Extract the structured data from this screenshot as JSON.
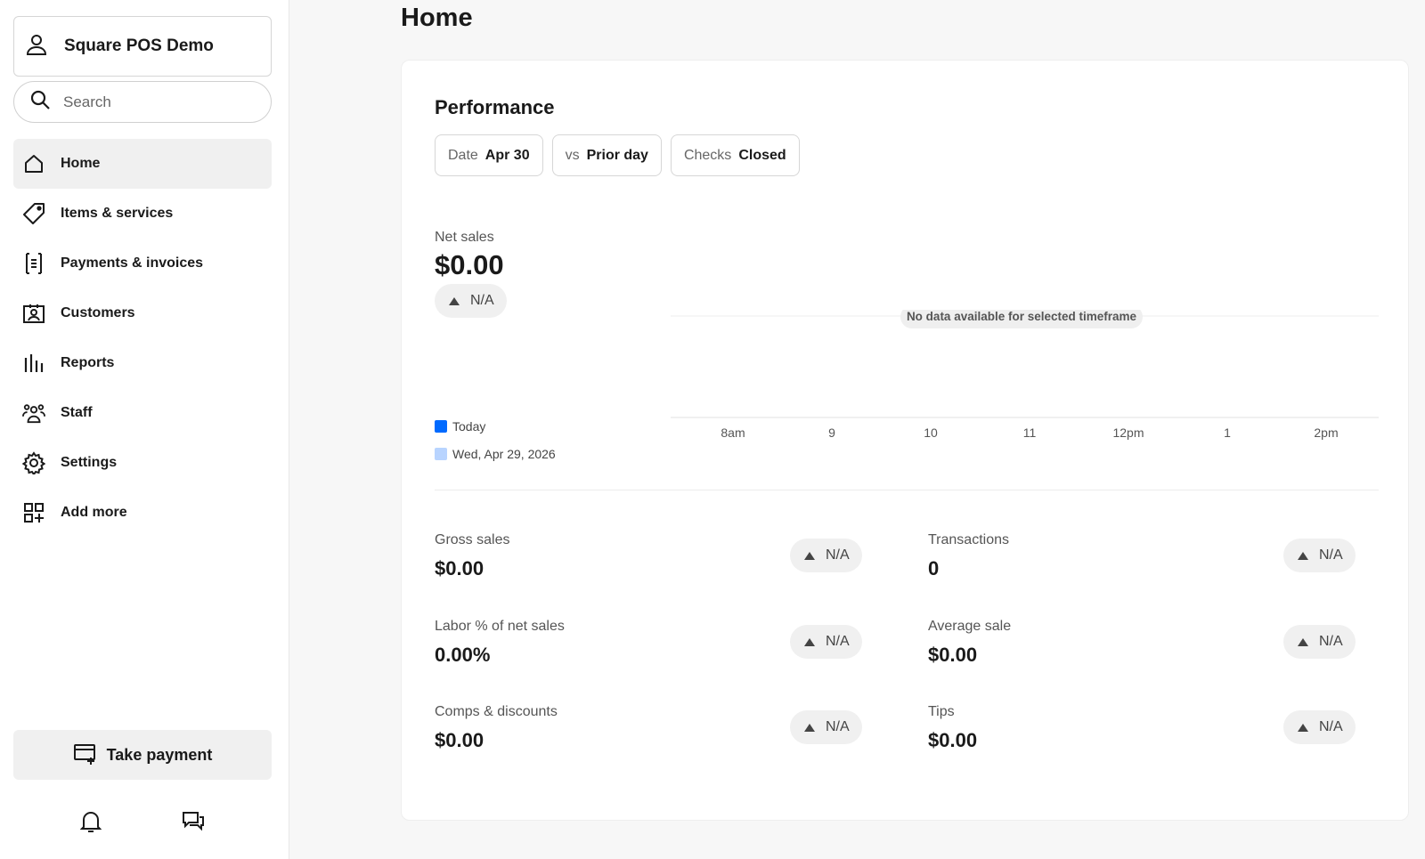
{
  "sidebar": {
    "account_name": "Square POS Demo",
    "search_placeholder": "Search",
    "items": [
      {
        "label": "Home",
        "icon": "home-icon",
        "active": true
      },
      {
        "label": "Items & services",
        "icon": "tag-icon"
      },
      {
        "label": "Payments & invoices",
        "icon": "receipt-icon"
      },
      {
        "label": "Customers",
        "icon": "contact-card-icon"
      },
      {
        "label": "Reports",
        "icon": "bar-chart-icon"
      },
      {
        "label": "Staff",
        "icon": "team-icon"
      },
      {
        "label": "Settings",
        "icon": "gear-icon"
      },
      {
        "label": "Add more",
        "icon": "add-apps-icon"
      }
    ],
    "take_payment_label": "Take payment"
  },
  "page": {
    "title": "Home"
  },
  "performance": {
    "title": "Performance",
    "filters": [
      {
        "key": "Date",
        "value": "Apr 30"
      },
      {
        "key": "vs",
        "value": "Prior day"
      },
      {
        "key": "Checks",
        "value": "Closed"
      }
    ],
    "net_sales_label": "Net sales",
    "net_sales_value": "$0.00",
    "net_sales_change": "N/A",
    "no_data_message": "No data available for selected timeframe",
    "x_ticks": [
      "8am",
      "9",
      "10",
      "11",
      "12pm",
      "1",
      "2pm"
    ],
    "legend": [
      {
        "label": "Today",
        "color": "#006aff"
      },
      {
        "label": "Wed, Apr 29, 2026",
        "color": "#b8d4ff"
      }
    ]
  },
  "metrics": [
    {
      "label": "Gross sales",
      "value": "$0.00",
      "change": "N/A"
    },
    {
      "label": "Transactions",
      "value": "0",
      "change": "N/A"
    },
    {
      "label": "Labor % of net sales",
      "value": "0.00%",
      "change": "N/A"
    },
    {
      "label": "Average sale",
      "value": "$0.00",
      "change": "N/A"
    },
    {
      "label": "Comps & discounts",
      "value": "$0.00",
      "change": "N/A"
    },
    {
      "label": "Tips",
      "value": "$0.00",
      "change": "N/A"
    }
  ],
  "colors": {
    "accent": "#006aff",
    "comparison": "#b8d4ff"
  }
}
